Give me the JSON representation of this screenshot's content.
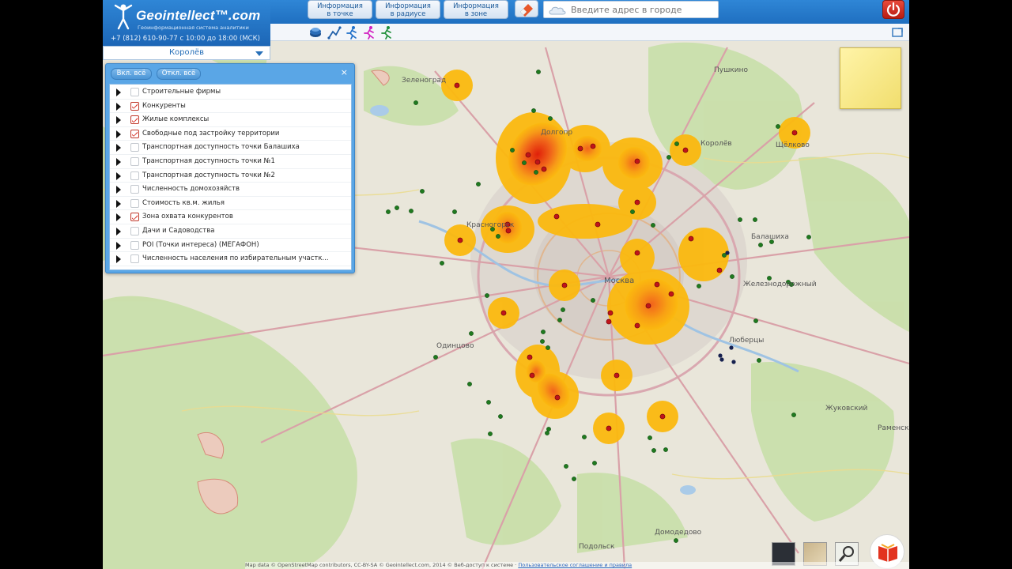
{
  "brand": {
    "name": "Geointellect™.com",
    "tagline": "Геоинформационная система аналитики",
    "phone": "+7 (812) 610-90-77 с 10:00 до 18:00 (МСК)"
  },
  "header": {
    "buttons": [
      {
        "line1": "Информация",
        "line2": "в точке"
      },
      {
        "line1": "Информация",
        "line2": "в радиусе"
      },
      {
        "line1": "Информация",
        "line2": "в зоне"
      }
    ],
    "search_placeholder": "Введите адрес в городе"
  },
  "district": {
    "selected": "Королёв"
  },
  "layers_panel": {
    "enable_all": "Вкл. всё",
    "disable_all": "Откл. всё",
    "close": "×",
    "layers": [
      {
        "label": "Строительные фирмы",
        "checked": false
      },
      {
        "label": "Конкуренты",
        "checked": true
      },
      {
        "label": "Жилые комплексы",
        "checked": true
      },
      {
        "label": "Свободные под застройку территории",
        "checked": true
      },
      {
        "label": "Транспортная доступность точки Балашиха",
        "checked": false
      },
      {
        "label": "Транспортная доступность точки №1",
        "checked": false
      },
      {
        "label": "Транспортная доступность точки №2",
        "checked": false
      },
      {
        "label": "Численность домохозяйств",
        "checked": false
      },
      {
        "label": "Стоимость кв.м. жилья",
        "checked": false
      },
      {
        "label": "Зона охвата конкурентов",
        "checked": true
      },
      {
        "label": "Дачи и Садоводства",
        "checked": false
      },
      {
        "label": "POI (Точки интереса) (МЕГАФОН)",
        "checked": false
      },
      {
        "label": "Численность населения по избирательным участк...",
        "checked": false
      }
    ]
  },
  "map_labels": [
    {
      "text": "Зеленоград"
    },
    {
      "text": "Долгопр"
    },
    {
      "text": "Королёв"
    },
    {
      "text": "Пушкино"
    },
    {
      "text": "Щёлково"
    },
    {
      "text": "Красногорск"
    },
    {
      "text": "Москва"
    },
    {
      "text": "Балашиха"
    },
    {
      "text": "Железнодорожный"
    },
    {
      "text": "Одинцово"
    },
    {
      "text": "Люберцы"
    },
    {
      "text": "Жуковский"
    },
    {
      "text": "Раменское"
    },
    {
      "text": "Домодедово"
    },
    {
      "text": "Подольск"
    }
  ],
  "footer": {
    "text": "Map data © OpenStreetMap contributors, CC-BY-SA    © Geointellect.com, 2014 © Веб-доступ к системе ·",
    "link": "Пользовательское соглашение и правила"
  }
}
